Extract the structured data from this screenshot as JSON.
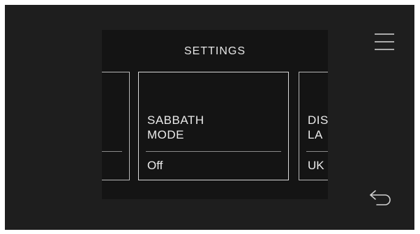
{
  "settings": {
    "title": "SETTINGS",
    "cards": [
      {
        "label": "",
        "value": ""
      },
      {
        "label": "SABBATH\nMODE",
        "value": "Off"
      },
      {
        "label": "DIS\nLA",
        "value": "UK"
      }
    ]
  },
  "icons": {
    "menu": "hamburger-menu-icon",
    "back": "back-arrow-icon"
  },
  "colors": {
    "screen_bg": "#1e1e1e",
    "panel_bg": "#141414",
    "text": "#eaeaea",
    "card_border": "#d9d9d9"
  }
}
